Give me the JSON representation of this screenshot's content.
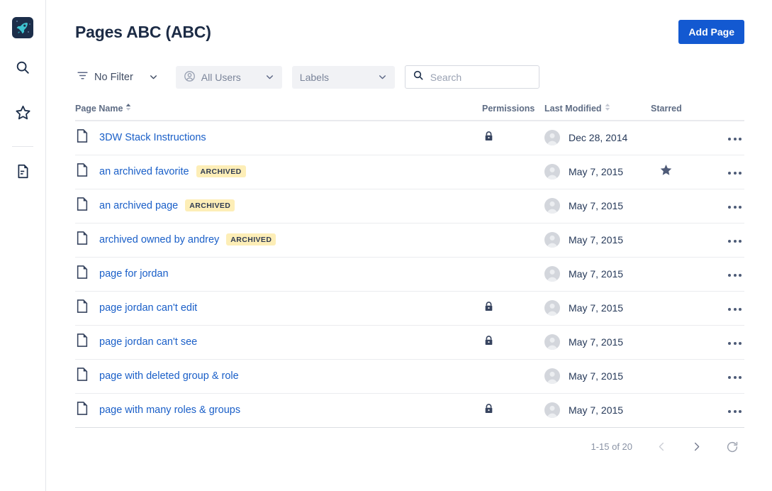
{
  "sidebar": {
    "logo": {
      "name": "rocket-logo",
      "bg": "#1c2e4a",
      "accent": "#3ec3d0"
    },
    "items": [
      {
        "icon": "search-icon",
        "label": "Search"
      },
      {
        "icon": "star-icon",
        "label": "Starred"
      },
      {
        "icon": "document-icon",
        "label": "Pages"
      }
    ]
  },
  "header": {
    "title": "Pages ABC (ABC)",
    "add_page_label": "Add Page",
    "accent_color": "#1359d1"
  },
  "filters": {
    "filter_label": "No Filter",
    "users_label": "All Users",
    "labels_label": "Labels",
    "search_placeholder": "Search",
    "search_value": ""
  },
  "table": {
    "columns": {
      "name": "Page Name",
      "permissions": "Permissions",
      "last_modified": "Last Modified",
      "starred": "Starred"
    },
    "sort_column": "Page Name",
    "rows": [
      {
        "name": "3DW Stack Instructions",
        "badge": "",
        "locked": true,
        "date": "Dec 28, 2014",
        "starred": false
      },
      {
        "name": "an archived favorite",
        "badge": "ARCHIVED",
        "locked": false,
        "date": "May 7, 2015",
        "starred": true
      },
      {
        "name": "an archived page",
        "badge": "ARCHIVED",
        "locked": false,
        "date": "May 7, 2015",
        "starred": false
      },
      {
        "name": "archived owned by andrey",
        "badge": "ARCHIVED",
        "locked": false,
        "date": "May 7, 2015",
        "starred": false
      },
      {
        "name": "page for jordan",
        "badge": "",
        "locked": false,
        "date": "May 7, 2015",
        "starred": false
      },
      {
        "name": "page jordan can't edit",
        "badge": "",
        "locked": true,
        "date": "May 7, 2015",
        "starred": false
      },
      {
        "name": "page jordan can't see",
        "badge": "",
        "locked": true,
        "date": "May 7, 2015",
        "starred": false
      },
      {
        "name": "page with deleted group & role",
        "badge": "",
        "locked": false,
        "date": "May 7, 2015",
        "starred": false
      },
      {
        "name": "page with many roles & groups",
        "badge": "",
        "locked": true,
        "date": "May 7, 2015",
        "starred": false
      }
    ]
  },
  "footer": {
    "count_label": "1-15 of 20",
    "prev_label": "Previous page",
    "next_label": "Next page",
    "refresh_label": "Refresh"
  }
}
